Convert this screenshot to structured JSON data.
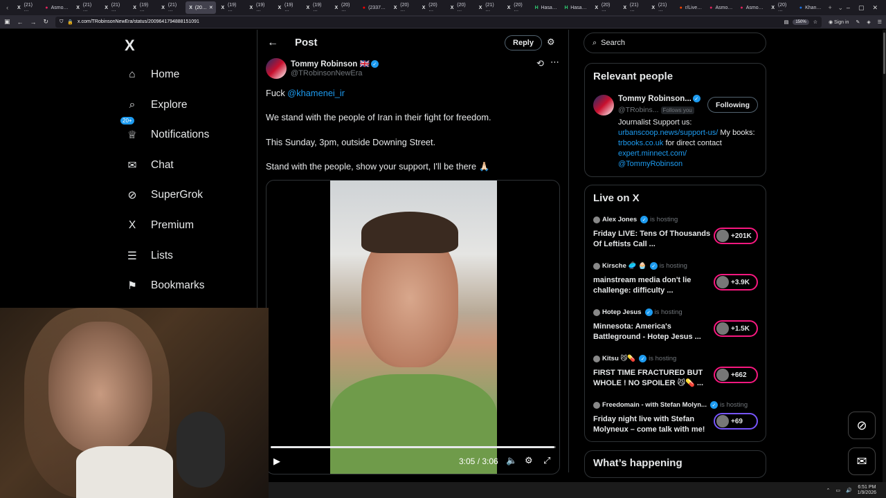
{
  "browser": {
    "tabs": [
      {
        "label": "(21) …",
        "icon": "x-icon",
        "color": "#e7e9ea"
      },
      {
        "label": "Asmo…",
        "icon": "asmon-icon",
        "color": "#e0245e"
      },
      {
        "label": "(21) …",
        "icon": "x-icon",
        "color": "#e7e9ea"
      },
      {
        "label": "(21) …",
        "icon": "x-icon",
        "color": "#e7e9ea"
      },
      {
        "label": "(19) …",
        "icon": "x-icon",
        "color": "#e7e9ea"
      },
      {
        "label": "(21) …",
        "icon": "x-icon",
        "color": "#e7e9ea"
      },
      {
        "label": "(20…",
        "icon": "x-icon",
        "color": "#e7e9ea",
        "active": true
      },
      {
        "label": "(19) …",
        "icon": "x-icon",
        "color": "#e7e9ea"
      },
      {
        "label": "(19) …",
        "icon": "x-icon",
        "color": "#e7e9ea"
      },
      {
        "label": "(19) …",
        "icon": "x-icon",
        "color": "#e7e9ea"
      },
      {
        "label": "(19) …",
        "icon": "x-icon",
        "color": "#e7e9ea"
      },
      {
        "label": "(20) …",
        "icon": "x-icon",
        "color": "#e7e9ea"
      },
      {
        "label": "(2337…",
        "icon": "youtube-icon",
        "color": "#ff0000"
      },
      {
        "label": "(20) …",
        "icon": "x-icon",
        "color": "#e7e9ea"
      },
      {
        "label": "(20) …",
        "icon": "x-icon",
        "color": "#e7e9ea"
      },
      {
        "label": "(20) …",
        "icon": "x-icon",
        "color": "#e7e9ea"
      },
      {
        "label": "(21) …",
        "icon": "x-icon",
        "color": "#e7e9ea"
      },
      {
        "label": "(20) …",
        "icon": "x-icon",
        "color": "#e7e9ea"
      },
      {
        "label": "Hasa…",
        "icon": "hasan-icon",
        "color": "#2ecc71"
      },
      {
        "label": "Hasa…",
        "icon": "hasan-icon",
        "color": "#2ecc71"
      },
      {
        "label": "(20) …",
        "icon": "x-icon",
        "color": "#e7e9ea"
      },
      {
        "label": "(21) …",
        "icon": "x-icon",
        "color": "#e7e9ea"
      },
      {
        "label": "(21) …",
        "icon": "x-icon",
        "color": "#e7e9ea"
      },
      {
        "label": "r/Live…",
        "icon": "reddit-icon",
        "color": "#ff4500"
      },
      {
        "label": "Asmo…",
        "icon": "asmon-icon",
        "color": "#e0245e"
      },
      {
        "label": "Asmo…",
        "icon": "asmon-icon",
        "color": "#e0245e"
      },
      {
        "label": "(20) …",
        "icon": "x-icon",
        "color": "#e7e9ea"
      },
      {
        "label": "Khan…",
        "icon": "khan-icon",
        "color": "#1a73e8"
      }
    ],
    "url": "x.com/TRobinsonNewEra/status/2009641794888151091",
    "zoom": "150%",
    "sign_in": "Sign in"
  },
  "nav": {
    "logo": "X",
    "items": [
      {
        "label": "Home",
        "icon": "home-icon",
        "glyph": "⌂"
      },
      {
        "label": "Explore",
        "icon": "search-icon",
        "glyph": "⌕"
      },
      {
        "label": "Notifications",
        "icon": "bell-icon",
        "glyph": "♕",
        "badge": "20+"
      },
      {
        "label": "Chat",
        "icon": "mail-icon",
        "glyph": "✉"
      },
      {
        "label": "SuperGrok",
        "icon": "grok-icon",
        "glyph": "⊘"
      },
      {
        "label": "Premium",
        "icon": "x-premium-icon",
        "glyph": "X"
      },
      {
        "label": "Lists",
        "icon": "list-icon",
        "glyph": "☰"
      },
      {
        "label": "Bookmarks",
        "icon": "bookmark-icon",
        "glyph": "⚑"
      }
    ]
  },
  "post": {
    "header_title": "Post",
    "reply_label": "Reply",
    "author_name": "Tommy Robinson 🇬🇧",
    "author_handle": "@TRobinsonNewEra",
    "text_prefix": "Fuck ",
    "mention": "@khamenei_ir",
    "line2": "We stand with the people of Iran in their fight for freedom.",
    "line3": "This Sunday, 3pm, outside Downing Street.",
    "line4": "Stand with the people, show your support, I'll be there 🙏🏻",
    "video_time": "3:05 / 3:06",
    "video_progress": 0.995
  },
  "right": {
    "search_placeholder": "Search",
    "relevant_title": "Relevant people",
    "rp_name": "Tommy Robinson...",
    "rp_handle": "@TRobins...",
    "rp_follows_you": "Follows you",
    "rp_follow_label": "Following",
    "rp_bio_1": "Journalist Support us:",
    "rp_bio_link1": "urbanscoop.news/support-us/",
    "rp_bio_2": " My books: ",
    "rp_bio_link2": "trbooks.co.uk",
    "rp_bio_3": " for direct contact ",
    "rp_bio_link3": "expert.minnect.com/",
    "rp_bio_link4": "@TommyRobinson",
    "live_title": "Live on X",
    "live_items": [
      {
        "host": "Alex Jones",
        "hosting": "is hosting",
        "title": "Friday LIVE: Tens Of Thousands Of Leftists Call ...",
        "count": "+201K"
      },
      {
        "host": "Kirsche 🥏 🧁",
        "hosting": "is hosting",
        "title": "mainstream media don't lie challenge: difficulty ...",
        "count": "+3.9K"
      },
      {
        "host": "Hotep Jesus",
        "hosting": "is hosting",
        "title": "Minnesota: America's Battleground - Hotep Jesus ...",
        "count": "+1.5K"
      },
      {
        "host": "Kitsu 😼💊",
        "hosting": "is hosting",
        "title": "FIRST TIME FRACTURED BUT WHOLE ! NO SPOILER 😼💊 ...",
        "count": "+662"
      },
      {
        "host": "Freedomain - with Stefan Molyn...",
        "hosting": "is hosting",
        "title": "Friday night live with Stefan Molyneux – come talk with me!",
        "count": "+69"
      }
    ],
    "whats_happening": "What’s happening"
  },
  "taskbar": {
    "time": "6:51 PM",
    "date": "1/9/2026"
  },
  "colors": {
    "accent": "#1d9bf0",
    "live": "#f91880",
    "border": "#2f3336"
  }
}
